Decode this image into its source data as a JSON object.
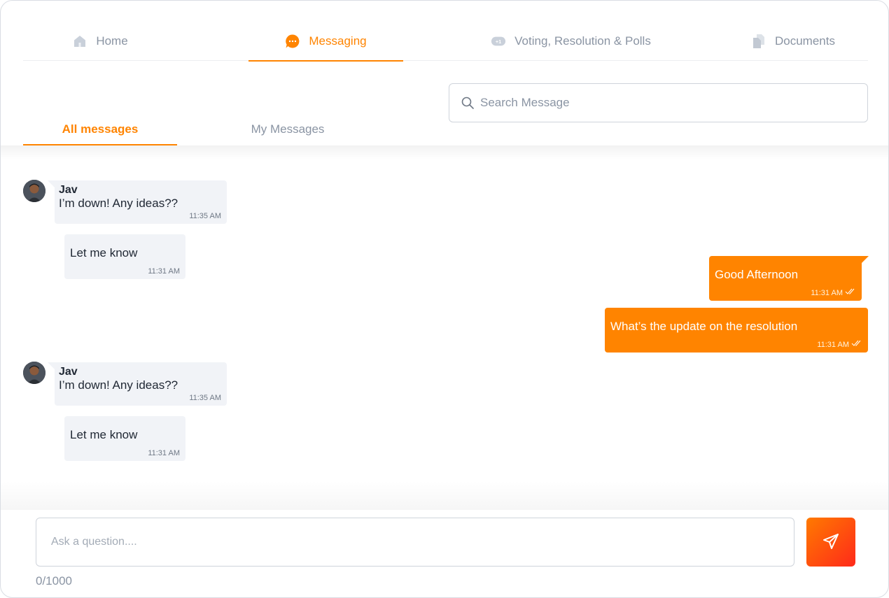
{
  "nav": {
    "tabs": [
      {
        "label": "Home",
        "icon": "home-icon",
        "active": false
      },
      {
        "label": "Messaging",
        "icon": "chat-bubble-icon",
        "active": true
      },
      {
        "label": "Voting, Resolution & Polls",
        "icon": "vote-plus-one-icon",
        "active": false
      },
      {
        "label": "Documents",
        "icon": "documents-icon",
        "active": false
      }
    ]
  },
  "subtabs": [
    {
      "label": "All messages",
      "active": true
    },
    {
      "label": "My Messages",
      "active": false
    }
  ],
  "search": {
    "placeholder": "Search Message"
  },
  "messages": [
    {
      "sender": "Jav",
      "text": "I’m down! Any ideas??",
      "time": "11:35 AM",
      "direction": "incoming"
    },
    {
      "text": "Let me know",
      "time": "11:31 AM",
      "direction": "incoming"
    },
    {
      "text": "Good Afternoon",
      "time": "11:31 AM",
      "direction": "outgoing",
      "status": "read"
    },
    {
      "text": "What’s the update on the resolution",
      "time": "11:31 AM",
      "direction": "outgoing",
      "status": "read"
    },
    {
      "sender": "Jav",
      "text": "I’m down! Any ideas??",
      "time": "11:35 AM",
      "direction": "incoming"
    },
    {
      "text": "Let me know",
      "time": "11:31 AM",
      "direction": "incoming"
    }
  ],
  "composer": {
    "placeholder": "Ask a question....",
    "counter": "0/1000"
  },
  "colors": {
    "accent": "#ff8400",
    "incoming_bubble": "#f1f3f7",
    "muted_text": "#8a94a3"
  }
}
